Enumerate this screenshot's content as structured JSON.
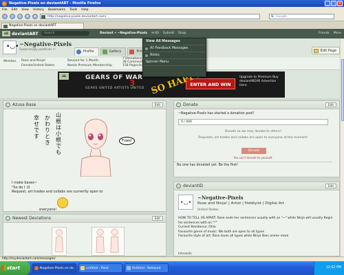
{
  "window": {
    "title": "Negative-Pixels on deviantART - Mozilla Firefox"
  },
  "menubar": [
    "File",
    "Edit",
    "View",
    "History",
    "Bookmarks",
    "Tools",
    "Help"
  ],
  "nav": {
    "url": "http://negative-pixels.deviantart.com/",
    "search_engine": "Google",
    "tab_title": "Negative-Pixels on deviantART"
  },
  "da_header": {
    "logo": "deviantART",
    "logo_mark": "dA",
    "search_placeholder": "Search",
    "user": "Deviant • ~Negative-Pixels",
    "messages_count": "60",
    "submit": "Submit",
    "shop": "Shop",
    "friends": "Friends",
    "more": "More"
  },
  "dropdown": {
    "items": [
      "View All Messages",
      "All Feedback Messages",
      "Notes",
      "Spinner Menu"
    ]
  },
  "profile": {
    "name": "~Negative-Pixels",
    "subtitle": "Surprisingly positive! c:",
    "tabs": [
      "Profile",
      "Gallery",
      "Prints"
    ],
    "edit_page": "Edit Page",
    "member_label": "Member",
    "realname": "Rose and Ninja!",
    "gender_location": "Female/United States",
    "deviant_for": "Deviant for 1 Month",
    "needs_membership": "Needs Premium Membership",
    "stats": [
      "7 Deviations",
      "38 Comments",
      "158 Pageviews"
    ]
  },
  "ad": {
    "logo": "dA",
    "brand": "GEARS OF WAR",
    "number": "3",
    "tagline": "GEARS UNITED  ARTISTS UNITED",
    "cta": "ENTER AND WIN",
    "upgrade": "Upgrade to Premium Buy deviantWEAR Advertise Here",
    "scrawl": "SO HAPPY!"
  },
  "azusa": {
    "title": "Azusa Base",
    "edit": "Edit",
    "jp_col1": "山根は小根でも",
    "jp_col2": "かわりとき",
    "jp_col3": "幸せです",
    "bubble": "Fuwa!",
    "text_line1": "I make bases~",
    "text_line2": "\"So do I :D",
    "text_line3": "Request, art trades and collabs are currently open to",
    "text_line4": "everyone!"
  },
  "newest": {
    "title": "Newest Deviations",
    "edit": "Edit"
  },
  "donate": {
    "title": "Donate",
    "edit": "Edit",
    "started": "~Negative-Pixels has started a donation pool!",
    "progress": "0 / 400",
    "progress_fraction": 0,
    "msg1": "Donate so we may donate to others!",
    "msg2": "Requests, art trades and collabs are open to everyone at the moment!",
    "button": "Donate",
    "note": "You can't donate to yourself.",
    "none": "No one has donated yet. Be the first!"
  },
  "deviantid": {
    "title": "deviantID",
    "edit": "Edit",
    "name": "~Negative-Pixels",
    "roles": "Rose and Ninja! | Artist | Hobbyist | Digital Art",
    "location": "United States",
    "line1": "HOW TO TELL US APART: Rose ends her sentences usually with an \"~\" while Ninja will usually Begin his sentences with an \"*\"",
    "line2": "Current Residence: Ohio",
    "line3": "Favourite genre of music: We both are open to all types",
    "line4": "Favourite style of art: Rose loves all types while Ninja likes anime more",
    "interests": "Interests"
  },
  "statusbar": {
    "text": "http://my.deviantart.com/messages/"
  },
  "taskbar": {
    "start": "start",
    "items": [
      "Negative-Pixels on de...",
      "untitled - Paint",
      "Untitled - Notepad"
    ],
    "clock": "12:02 PM"
  }
}
